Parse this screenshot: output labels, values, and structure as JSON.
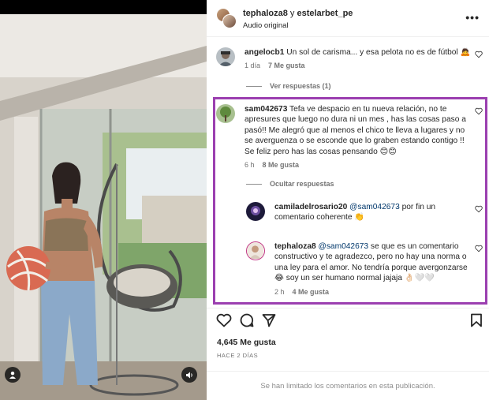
{
  "header": {
    "username": "tephaloza8",
    "connector": "y",
    "collab": "estelarbet_pe",
    "audio": "Audio original",
    "more_label": "•••"
  },
  "comments": [
    {
      "username": "angelocb1",
      "text": "Un sol de carisma... y esa pelota no es de fútbol 🙇",
      "time": "1 día",
      "likes": "7 Me gusta"
    },
    {
      "username": "sam042673",
      "text": "Tefa ve despacio en tu nueva relación, no te apresures que luego no dura ni un mes , has las cosas paso a pasó!! Me alegró que al menos el chico te lleva a lugares y no se averguenza o se esconde que lo graben estando contigo !! Se feliz pero has las cosas pensando 😊😊",
      "time": "6 h",
      "likes": "8 Me gusta"
    }
  ],
  "view_replies": "Ver respuestas (1)",
  "hide_replies": "Ocultar respuestas",
  "replies": [
    {
      "username": "camiladelrosario20",
      "mention": "@sam042673",
      "text": " por fin un comentario coherente 👏",
      "time": "",
      "likes": ""
    },
    {
      "username": "tephaloza8",
      "mention": "@sam042673",
      "text": " se que es un comentario constructivo y te agradezco, pero no hay una norma o una ley para el amor. No tendría porque avergonzarse 😂 soy un ser humano normal jajaja 👌🏻🤍🤍",
      "time": "2 h",
      "likes": "4 Me gusta"
    }
  ],
  "likes_count": "4,645 Me gusta",
  "date": "HACE 2 DÍAS",
  "limited_notice": "Se han limitado los comentarios en esta publicación.",
  "colors": {
    "highlight": "#9b3fb0",
    "link": "#00376b",
    "muted": "#737373"
  },
  "icons": [
    "heart-icon",
    "comment-icon",
    "share-icon",
    "bookmark-icon",
    "user-tag-icon",
    "sound-icon",
    "more-icon"
  ]
}
